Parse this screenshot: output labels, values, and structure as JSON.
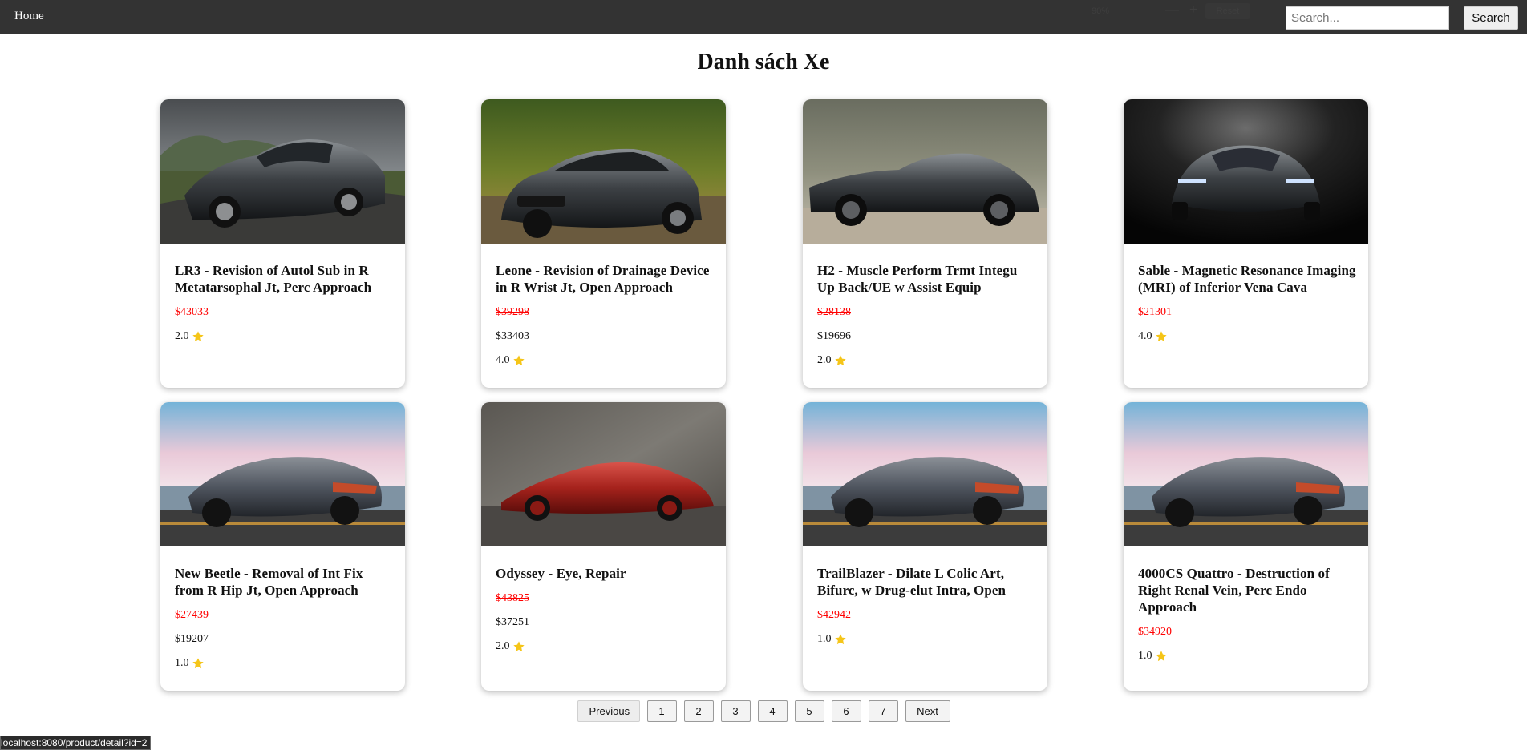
{
  "nav": {
    "home_label": "Home",
    "zoom_value": "90%",
    "zoom_minus": "—",
    "zoom_plus": "+",
    "zoom_reset": "Reset"
  },
  "search": {
    "placeholder": "Search...",
    "button_label": "Search"
  },
  "page": {
    "title": "Danh sách Xe"
  },
  "products": [
    {
      "name": "LR3 - Revision of Autol Sub in R Metatarsophal Jt, Perc Approach",
      "price": "$43033",
      "sale_price": null,
      "rating": "2.0",
      "image": "dark-grey-coupe-mountain-road"
    },
    {
      "name": "Leone - Revision of Drainage Device in R Wrist Jt, Open Approach",
      "price": "$39298",
      "sale_price": "$33403",
      "rating": "4.0",
      "image": "black-sports-car-tree-lined-road"
    },
    {
      "name": "H2 - Muscle Perform Trmt Integu Up Back/UE w Assist Equip",
      "price": "$28138",
      "sale_price": "$19696",
      "rating": "2.0",
      "image": "black-coupe-side-view-trees"
    },
    {
      "name": "Sable - Magnetic Resonance Imaging (MRI) of Inferior Vena Cava",
      "price": "$21301",
      "sale_price": null,
      "rating": "4.0",
      "image": "concept-car-dark-studio"
    },
    {
      "name": "New Beetle - Removal of Int Fix from R Hip Jt, Open Approach",
      "price": "$27439",
      "sale_price": "$19207",
      "rating": "1.0",
      "image": "grey-concept-car-seaside"
    },
    {
      "name": "Odyssey - Eye, Repair",
      "price": "$43825",
      "sale_price": "$37251",
      "rating": "2.0",
      "image": "red-supercar-concrete-wall"
    },
    {
      "name": "TrailBlazer - Dilate L Colic Art, Bifurc, w Drug-elut Intra, Open",
      "price": "$42942",
      "sale_price": null,
      "rating": "1.0",
      "image": "grey-concept-car-seaside"
    },
    {
      "name": "4000CS Quattro - Destruction of Right Renal Vein, Perc Endo Approach",
      "price": "$34920",
      "sale_price": null,
      "rating": "1.0",
      "image": "grey-concept-car-seaside"
    }
  ],
  "pagination": {
    "previous": "Previous",
    "next": "Next",
    "pages": [
      "1",
      "2",
      "3",
      "4",
      "5",
      "6",
      "7"
    ]
  },
  "statusbar": {
    "url": "localhost:8080/product/detail?id=2"
  },
  "colors": {
    "navbar": "#333333",
    "price_red": "#ff0000",
    "star": "#f5c518"
  }
}
